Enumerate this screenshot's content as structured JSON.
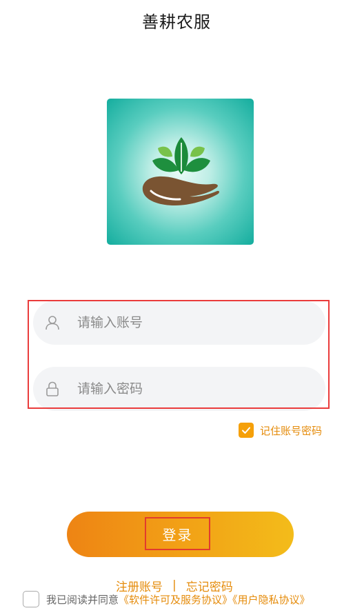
{
  "header": {
    "title": "善耕农服"
  },
  "logo": {
    "icon": "leaves-in-hand-logo"
  },
  "login_form": {
    "account_placeholder": "请输入账号",
    "password_placeholder": "请输入密码",
    "account_icon": "user-icon",
    "password_icon": "lock-icon",
    "remember_label": "记住账号密码",
    "remember_checked": true
  },
  "login_button": {
    "label": "登录"
  },
  "links": {
    "register": "注册账号",
    "separator": "|",
    "forgot": "忘记密码"
  },
  "agreement": {
    "prefix": "我已阅读并同意",
    "software_license": "《软件许可及服务协议》",
    "privacy_policy": "《用户隐私协议》",
    "checked": false
  },
  "colors": {
    "accent": "#e58b0a",
    "button_start": "#ee8414",
    "button_end": "#f3bc1a",
    "logo_teal": "#14ad9e",
    "highlight_red": "#ea3b3b"
  }
}
